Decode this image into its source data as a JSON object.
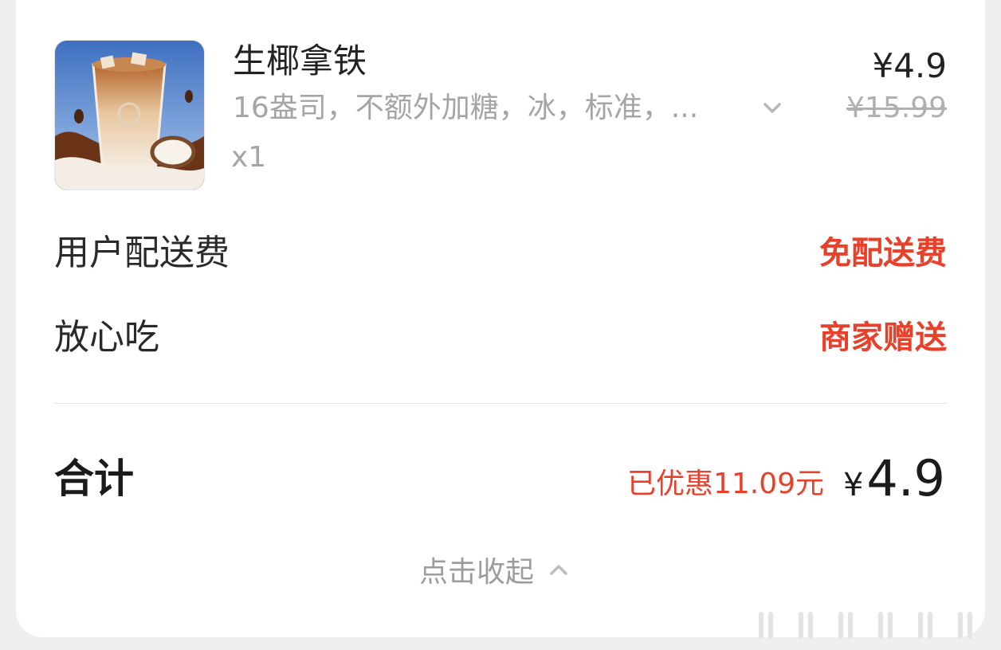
{
  "item": {
    "name": "生椰拿铁",
    "spec": "16盎司，不额外加糖，冰，标准，...",
    "quantity": "x1",
    "price": "¥4.9",
    "original_price": "¥15.99",
    "image_icon": "coconut-latte-image"
  },
  "fees": [
    {
      "label": "用户配送费",
      "value": "免配送费"
    },
    {
      "label": "放心吃",
      "value": "商家赠送"
    }
  ],
  "total": {
    "label": "合计",
    "discount": "已优惠11.09元",
    "currency": "¥",
    "amount": "4.9"
  },
  "collapse": {
    "label": "点击收起",
    "icon": "chevron-up-icon"
  },
  "colors": {
    "accent_red": "#e8412b",
    "text_dark": "#222222",
    "text_gray": "#a5a5a5"
  }
}
